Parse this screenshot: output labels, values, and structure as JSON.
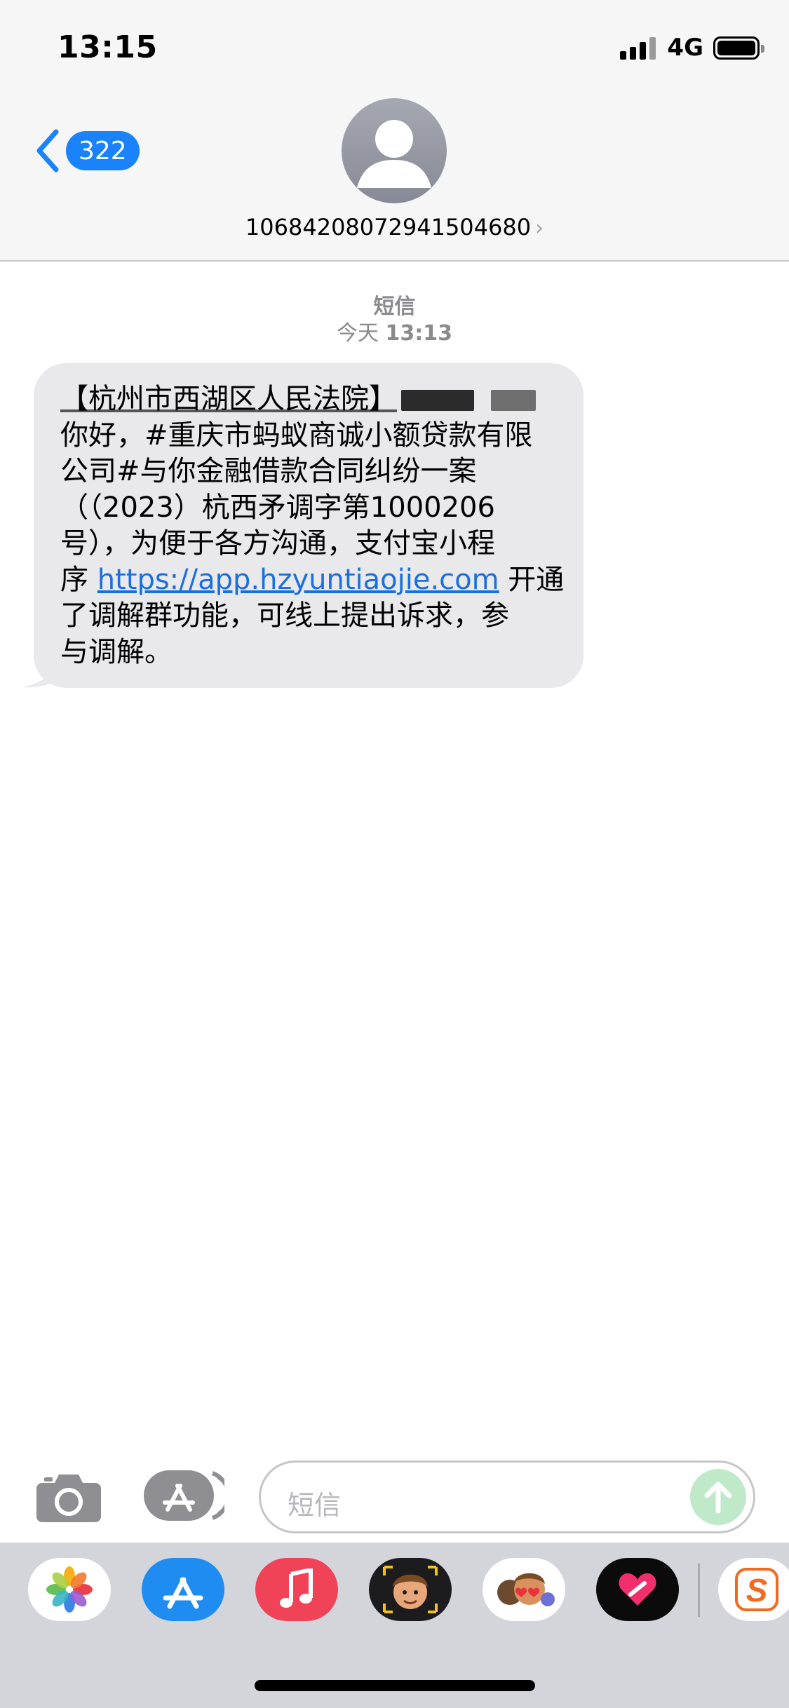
{
  "status_bar": {
    "time": "13:15",
    "network": "4G"
  },
  "header": {
    "back_count": "322",
    "contact": "10684208072941504680",
    "contact_chevron": "›"
  },
  "conversation": {
    "service_label": "短信",
    "timestamp_day": "今天",
    "timestamp_time": "13:13",
    "message": {
      "sender_tag": "【杭州市西湖区人民法院】",
      "line2": "你好，#重庆市蚂蚁商诚小额贷款有限",
      "line3": "公司#与你金融借款合同纠纷一案",
      "line4": "（（2023）杭西矛调字第1000206",
      "line5": "号），为便于各方沟通，支付宝小程",
      "line6_prefix": "序",
      "link": "https://app.hzyuntiaojie.com",
      "line6_suffix": " 开通",
      "line7": "了调解群功能，可线上提出诉求，参",
      "line8": "与调解。"
    }
  },
  "input_bar": {
    "placeholder": "短信",
    "camera_icon": "camera-icon",
    "apps_icon": "app-store-icon",
    "send_icon": "arrow-up-icon"
  },
  "app_drawer": {
    "apps": [
      "Photos",
      "App Store",
      "Music",
      "Memoji",
      "Memoji Stickers",
      "Digital Touch",
      "Sogou"
    ]
  },
  "colors": {
    "accent": "#1a82fb",
    "bubble": "#e9e9eb",
    "link": "#1a6fe0",
    "send_disabled": "#bfe9c9"
  }
}
